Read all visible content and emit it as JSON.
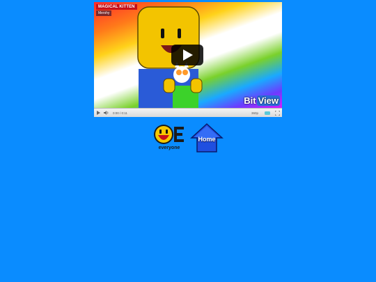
{
  "video": {
    "title": "MAGICAL KITTEN",
    "author": "Mershy",
    "watermark_bit": "Bit",
    "watermark_view": "View"
  },
  "controls": {
    "time": "0:00 / 0:11",
    "quality": "360p",
    "icons": [
      "play-icon",
      "volume-icon",
      "cc-icon",
      "fullscreen-icon"
    ]
  },
  "logos": {
    "oe_label": "everyone",
    "home_label": "Home"
  },
  "colors": {
    "background": "#0a8cff",
    "title_badge": "#c8101a",
    "home_blue": "#1f4fe0"
  }
}
